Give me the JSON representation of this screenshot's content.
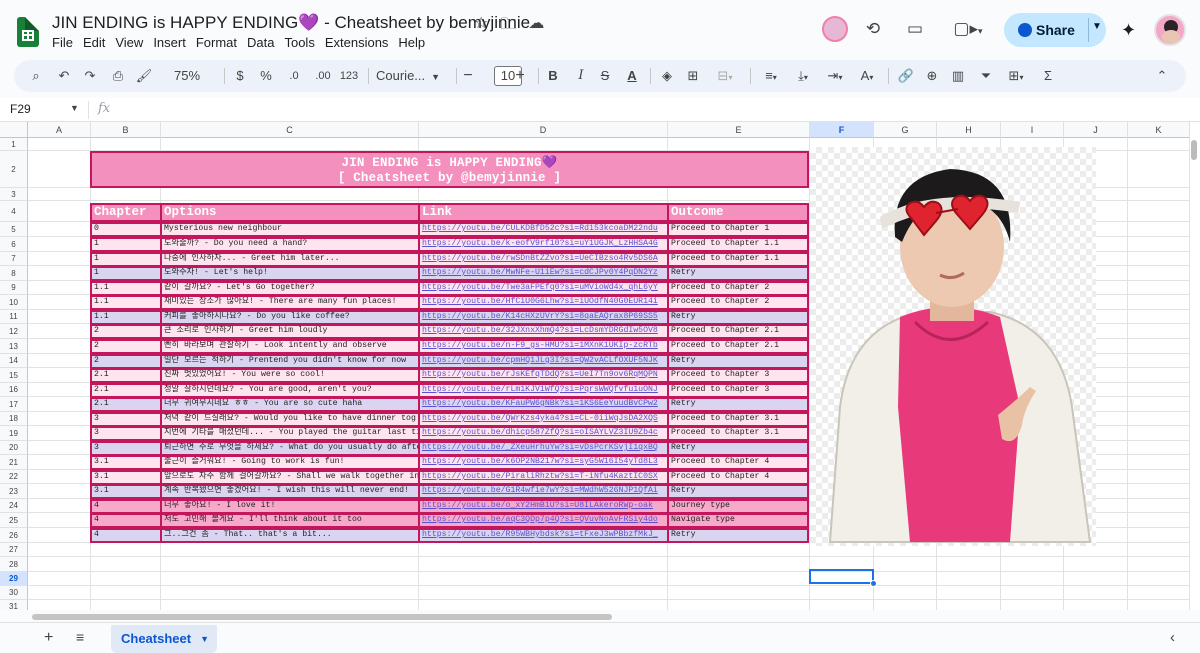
{
  "document": {
    "title": "JIN ENDING is HAPPY ENDING💜 - Cheatsheet by bemyjinnie"
  },
  "title_icons": [
    "star-icon",
    "move-folder-icon",
    "cloud-status-icon"
  ],
  "menu": [
    "File",
    "Edit",
    "View",
    "Insert",
    "Format",
    "Data",
    "Tools",
    "Extensions",
    "Help"
  ],
  "share": {
    "label": "Share"
  },
  "toolbar": {
    "zoom": "75%",
    "currency": "$",
    "percent": "%",
    "decrease_decimal": ".0",
    "increase_decimal": ".00",
    "number_format": "123",
    "font": "Courie...",
    "font_size": "10",
    "bold": "B",
    "italic": "I",
    "strike": "S",
    "text_color": "A"
  },
  "formula_bar": {
    "cell_ref": "F29",
    "fx": "fx",
    "value": ""
  },
  "columns": [
    "A",
    "B",
    "C",
    "D",
    "E",
    "F",
    "G",
    "H",
    "I",
    "J",
    "K"
  ],
  "selected_column": "F",
  "rows": [
    "1",
    "2",
    "3",
    "4",
    "5",
    "6",
    "7",
    "8",
    "9",
    "10",
    "11",
    "12",
    "13",
    "14",
    "15",
    "16",
    "17",
    "18",
    "19",
    "20",
    "21",
    "22",
    "23",
    "24",
    "25",
    "26",
    "27",
    "28",
    "29",
    "30",
    "31"
  ],
  "selected_row": "29",
  "sheet_title": {
    "line1": "JIN ENDING is HAPPY ENDING💜",
    "line2": "[ Cheatsheet by @bemyjinnie ]"
  },
  "table": {
    "headers": [
      "Chapter",
      "Options",
      "Link",
      "Outcome"
    ],
    "rows": [
      [
        "0",
        "Mysterious new neighbour",
        "https://youtu.be/CULKDBfD52c?si=Rd153kcoaDM22ndu",
        "Proceed to Chapter 1"
      ],
      [
        "1",
        "도와줄까? - Do you need a hand?",
        "https://youtu.be/k-eofV9rf10?si=uY1UGJK_LzHHSA4G",
        "Proceed to Chapter 1.1"
      ],
      [
        "1",
        "나중에 인사하자... - Greet him later...",
        "https://youtu.be/rwSDnBtZZvo?si=UeCIBzso4Rv5DS6A",
        "Proceed to Chapter 1.1"
      ],
      [
        "1",
        "도와주자! - Let's help!",
        "https://youtu.be/MwNFe-U1iEw?si=cdCJPv0Y4PqDN2Yz",
        "Retry"
      ],
      [
        "1.1",
        "같이 갈까요? - Let's Go together?",
        "https://youtu.be/Twe3aFPEfq0?si=uMVioWd4x_qhL6yY",
        "Proceed to Chapter 2"
      ],
      [
        "1.1",
        "재미있는 장소가 많아요! - There are many fun places!",
        "https://youtu.be/HfCiU0G6Lhw?si=iUOdfN40G0EUR14i",
        "Proceed to Chapter 2"
      ],
      [
        "1.1",
        "커피를 좋아하시나요? - Do you like coffee?",
        "https://youtu.be/K14cHXzUVrY?si=8qaEAQrax8P69SS5",
        "Retry"
      ],
      [
        "2",
        "큰 소리로 인사하기 - Greet him loudly",
        "https://youtu.be/32JXnxXhmQ4?si=LcDsmYDRGdIw5OV8",
        "Proceed to Chapter 2.1"
      ],
      [
        "2",
        "빤히 바라보며 관찰하기 - Look intently and observe",
        "https://youtu.be/n-F9_gs-HMU?si=1MXnK1UKIp-zcRTb",
        "Proceed to Chapter 2.1"
      ],
      [
        "2",
        "일단 모르는 척하기 - Prentend you didn't know for now",
        "https://youtu.be/cpmHQ1JLg3I?si=QW2vACLfOXUF5NJK",
        "Retry"
      ],
      [
        "2.1",
        "진짜 멋있었어요! - You were so cool!",
        "https://youtu.be/rJsKEfqTDdQ?si=UeI7Tn9ov6RqMQPN",
        "Proceed to Chapter 3"
      ],
      [
        "2.1",
        "정말 잘하시던데요? - You are good, aren't you?",
        "https://youtu.be/rLm1KJV1WfQ?si=PqrsWWQfvfu1uONJ",
        "Proceed to Chapter 3"
      ],
      [
        "2.1",
        "너무 귀여우시네요 ㅎㅎ - You are so cute haha",
        "https://youtu.be/KFauPW6gNBk?si=1KS6EeYuudBvCPw2",
        "Retry"
      ],
      [
        "3",
        "저녁 같이 드실래요? - Would you like to have dinner tog",
        "https://youtu.be/QWrKzs4yka4?si=CL-0iiWqJsDA2XQS",
        "Proceed to Chapter 3.1"
      ],
      [
        "3",
        "지번에 기타를 매셨던데... - You played the guitar last tim",
        "https://youtu.be/dhicp587ZfQ?si=oISAYLVZ3IU9Zb4c",
        "Proceed to Chapter 3.1"
      ],
      [
        "3",
        "퇴근하면 주로 무엇을 하세요? - What do you usually do afte",
        "https://youtu.be/_ZXeuHrhuYw?si=vDsPcrKSvjI1qxBQ",
        "Retry"
      ],
      [
        "3.1",
        "출근이 즐거워요! - Going to work is fun!",
        "https://youtu.be/k6OP2NB217w?si=syG5W16I54yTd8L3",
        "Proceed to Chapter 4"
      ],
      [
        "3.1",
        "앞으로도 자주 함께 걸어갈까요? - Shall we walk together in",
        "https://youtu.be/PiraliRhztw?si=T-iNfu4KaztIC0SX",
        "Proceed to Chapter 4"
      ],
      [
        "3.1",
        "계속 반복됐으면 좋겠어요! - I wish this will never end!",
        "https://youtu.be/G1R4wfie7wY?si=MWdhW526NJP1QfAi",
        "Retry"
      ],
      [
        "4",
        "너무 좋아요! - I love it!",
        "https://youtu.be/o_xY2HmB1U?si=U8ILAkeroRWp-oak",
        "Journey type"
      ],
      [
        "4",
        "저도 고민해 볼게요 - I'll think about it too",
        "https://youtu.be/aqC3QDp7p4Q?si=QVuvNoAvFRSiy4do",
        "Navigate type"
      ],
      [
        "4",
        "그..그건 좀 - That.. that's a bit...",
        "https://youtu.be/R95WBHybdsk?si=tFxeJ3wPBbzfMkJ_",
        "Retry"
      ]
    ],
    "row_styles": [
      "light",
      "light",
      "light",
      "blue",
      "light",
      "light",
      "blue",
      "light",
      "light",
      "blue",
      "light",
      "light",
      "blue",
      "light",
      "light",
      "blue",
      "light",
      "light",
      "blue",
      "pink",
      "pink",
      "blue"
    ]
  },
  "sheet_tabs": [
    {
      "label": "Cheatsheet",
      "active": true
    }
  ],
  "colors": {
    "pink_header": "#f490bd",
    "pink_border": "#c2185b",
    "row_light": "#fde4ef",
    "row_blue": "#d9d5f0",
    "row_pink": "#f7a9cb",
    "share_bg": "#c2e7ff",
    "link_color": "#5b52d0"
  }
}
